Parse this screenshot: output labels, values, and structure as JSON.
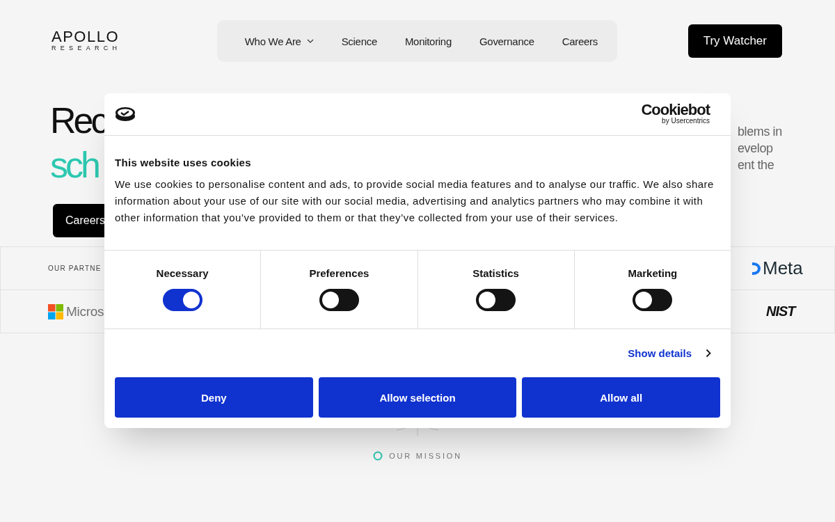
{
  "logo": {
    "name": "APOLLO",
    "sub": "RESEARCH"
  },
  "nav": [
    {
      "label": "Who We Are",
      "has_menu": true
    },
    {
      "label": "Science",
      "has_menu": false
    },
    {
      "label": "Monitoring",
      "has_menu": false
    },
    {
      "label": "Governance",
      "has_menu": false
    },
    {
      "label": "Careers",
      "has_menu": false
    }
  ],
  "cta": "Try Watcher",
  "hero": {
    "line_1": "Rec",
    "line_2": "sch",
    "button": "Careers",
    "side_text": [
      "blems in",
      "evelop",
      "ent the"
    ]
  },
  "partners": {
    "label": "OUR PARTNE",
    "logos": [
      {
        "kind": "microsoft",
        "text": "Micros"
      },
      {
        "kind": "meta",
        "text": "Meta"
      },
      {
        "kind": "nist",
        "text": "NIST"
      }
    ]
  },
  "mission": "OUR MISSION",
  "cookie_dialog": {
    "brand": "Cookiebot",
    "brand_sub": "by Usercentrics",
    "title": "This website uses cookies",
    "text": "We use cookies to personalise content and ads, to provide social media features and to analyse our traffic. We also share information about your use of our site with our social media, advertising and analytics partners who may combine it with other information that you’ve provided to them or that they’ve collected from your use of their services.",
    "categories": [
      {
        "label": "Necessary",
        "checked": true
      },
      {
        "label": "Preferences",
        "checked": false
      },
      {
        "label": "Statistics",
        "checked": false
      },
      {
        "label": "Marketing",
        "checked": false
      }
    ],
    "show_details": "Show details",
    "buttons": [
      "Deny",
      "Allow selection",
      "Allow all"
    ]
  }
}
